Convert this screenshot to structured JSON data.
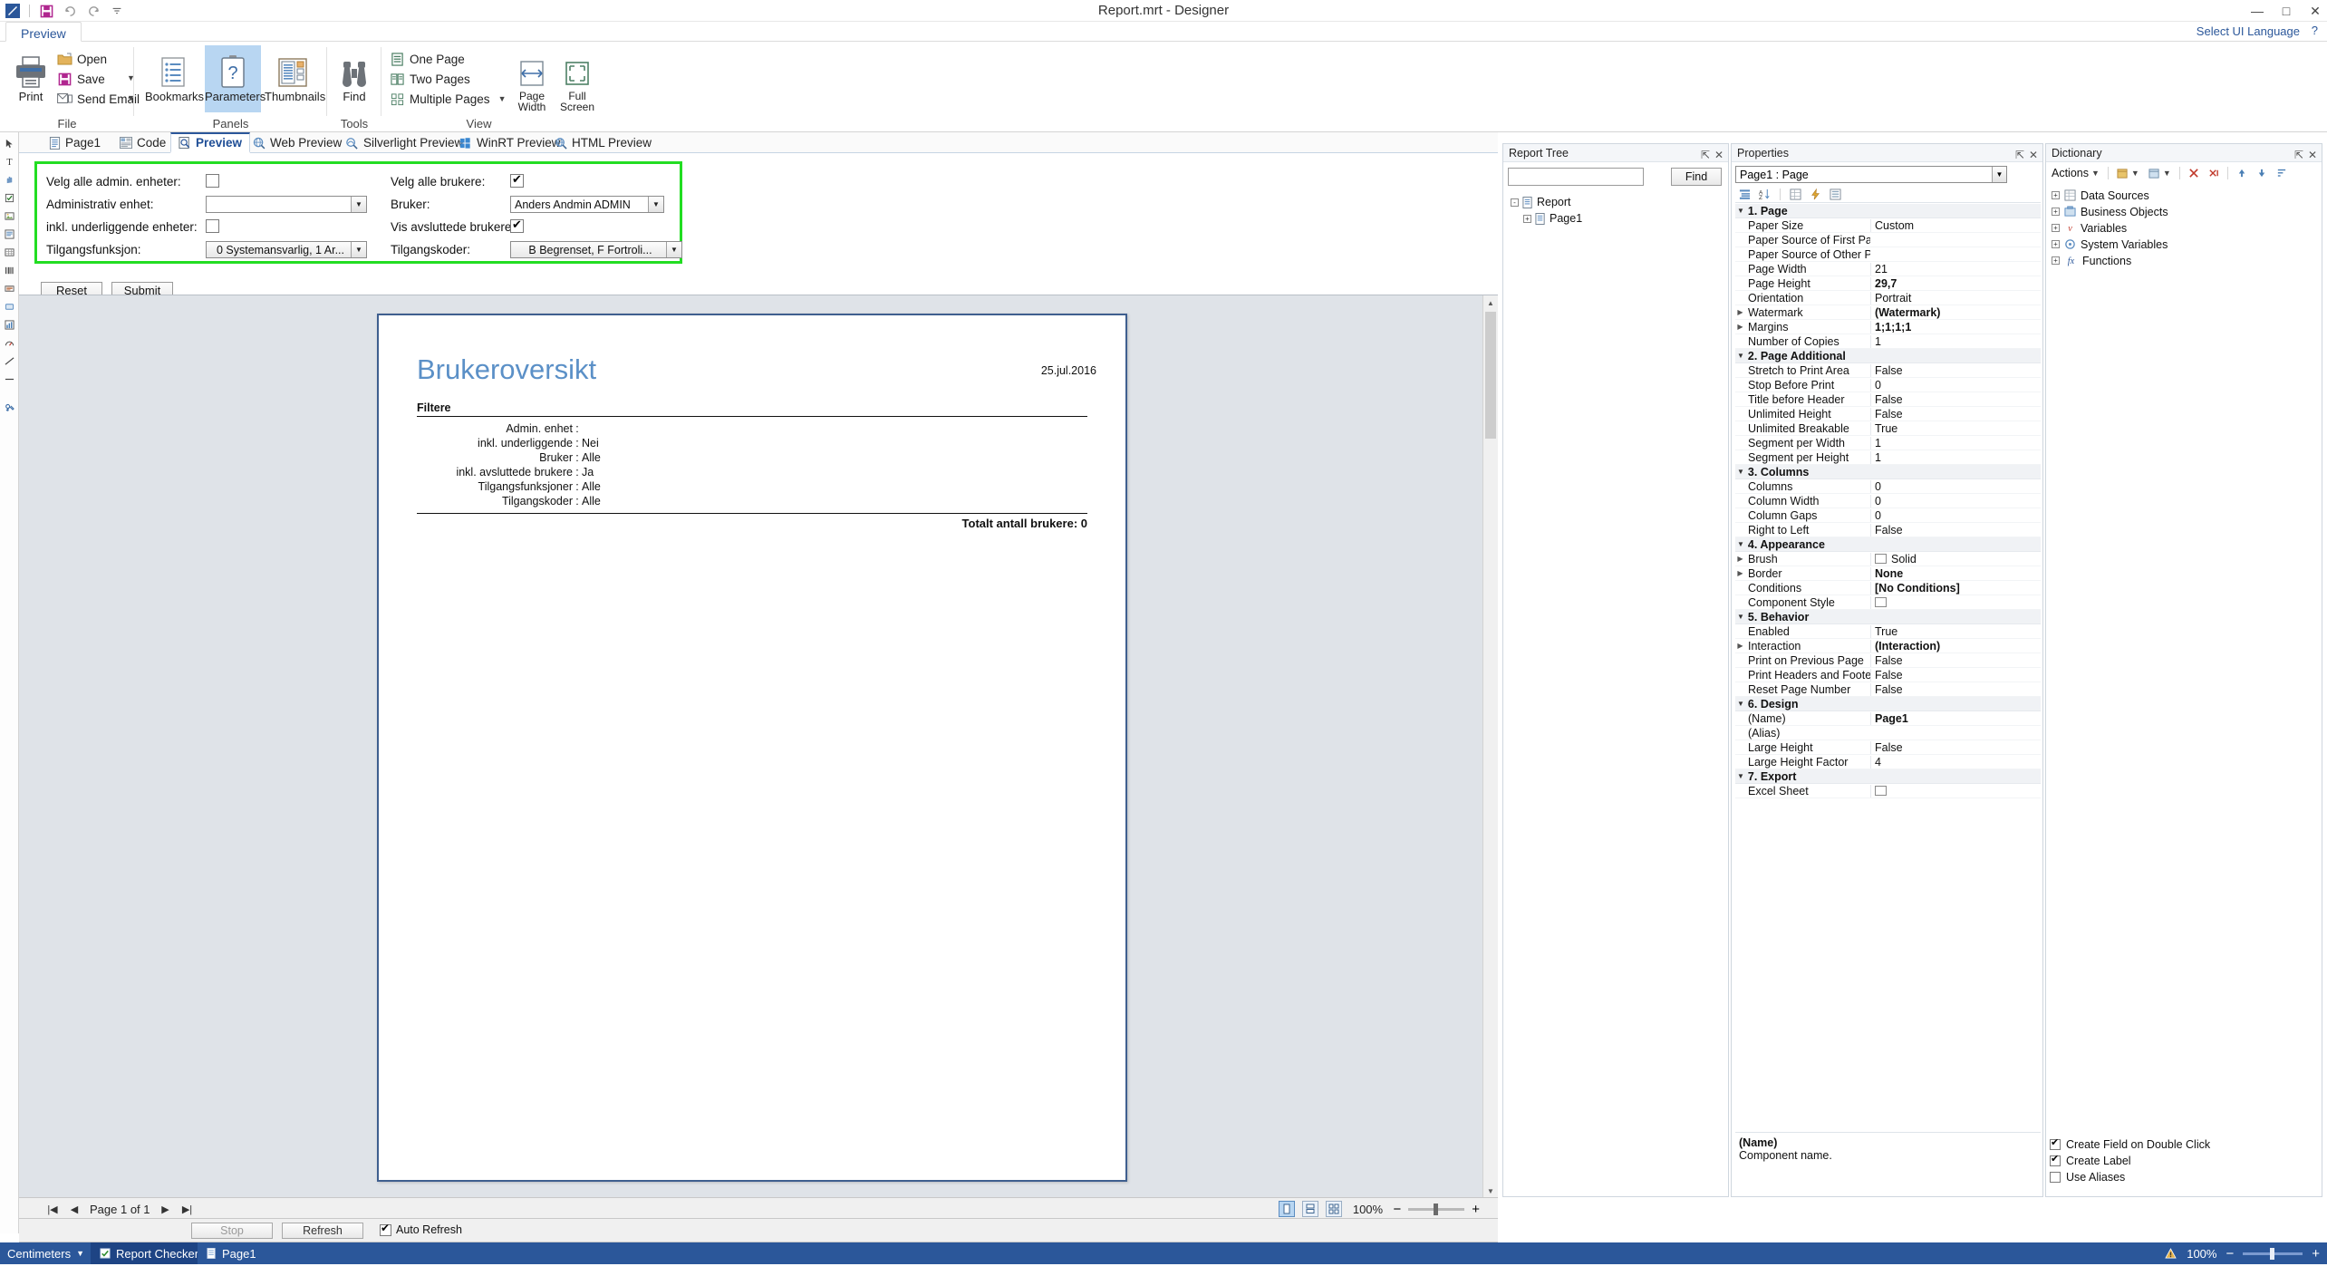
{
  "window": {
    "title": "Report.mrt - Designer",
    "quick_access": [
      "designer-logo-icon",
      "save-icon",
      "undo-icon",
      "redo-icon",
      "customize-qat-icon"
    ],
    "controls": {
      "minimize": "—",
      "maximize": "□",
      "close": "✕"
    }
  },
  "ribbon": {
    "tab": "Preview",
    "ui_language": "Select UI Language",
    "help": "?",
    "groups": [
      {
        "label": "File"
      },
      {
        "label": "Panels"
      },
      {
        "label": "Tools"
      },
      {
        "label": "View"
      }
    ],
    "buttons": {
      "print": "Print",
      "open": "Open",
      "save": "Save",
      "send_email": "Send Email",
      "bookmarks": "Bookmarks",
      "parameters": "Parameters",
      "thumbnails": "Thumbnails",
      "find": "Find",
      "one_page": "One Page",
      "two_pages": "Two Pages",
      "multiple_pages": "Multiple Pages",
      "page_width": "Page Width",
      "full_screen": "Full Screen"
    }
  },
  "doc_tabs": [
    {
      "label": "Page1",
      "icon": "page-icon",
      "active": false
    },
    {
      "label": "Code",
      "icon": "code-icon",
      "active": false
    },
    {
      "label": "Preview",
      "icon": "preview-icon",
      "active": true
    },
    {
      "label": "Web Preview",
      "icon": "web-preview-icon",
      "active": false
    },
    {
      "label": "Silverlight Preview",
      "icon": "silverlight-preview-icon",
      "active": false
    },
    {
      "label": "WinRT Preview",
      "icon": "winrt-preview-icon",
      "active": false
    },
    {
      "label": "HTML Preview",
      "icon": "html-preview-icon",
      "active": false
    }
  ],
  "parameters": {
    "left": [
      {
        "label": "Velg alle admin. enheter:",
        "type": "checkbox",
        "checked": false
      },
      {
        "label": "Administrativ enhet:",
        "type": "combo",
        "value": ""
      },
      {
        "label": "inkl. underliggende enheter:",
        "type": "checkbox",
        "checked": false
      },
      {
        "label": "Tilgangsfunksjon:",
        "type": "combo-button",
        "value": "0 Systemansvarlig, 1 Ar..."
      }
    ],
    "right": [
      {
        "label": "Velg alle brukere:",
        "type": "checkbox",
        "checked": true
      },
      {
        "label": "Bruker:",
        "type": "combo",
        "value": "Anders Andmin ADMIN"
      },
      {
        "label": "Vis avsluttede brukere:",
        "type": "checkbox",
        "checked": true
      },
      {
        "label": "Tilgangskoder:",
        "type": "combo-button",
        "value": "B Begrenset, F Fortroli..."
      }
    ],
    "reset_button": "Reset",
    "submit_button": "Submit"
  },
  "report": {
    "title": "Brukeroversikt",
    "date": "25.jul.2016",
    "filters_heading": "Filtere",
    "filters": [
      {
        "key": "Admin. enhet",
        "value": ""
      },
      {
        "key": "inkl. underliggende",
        "value": "Nei"
      },
      {
        "key": "Bruker",
        "value": "Alle"
      },
      {
        "key": "inkl. avsluttede brukere",
        "value": "Ja"
      },
      {
        "key": "Tilgangsfunksjoner",
        "value": "Alle"
      },
      {
        "key": "Tilgangskoder",
        "value": "Alle"
      }
    ],
    "total": "Totalt antall brukere: 0"
  },
  "preview_bar": {
    "page_indicator": "Page 1 of 1",
    "zoom": "100%",
    "nav": {
      "first": "|◀",
      "prev": "◀",
      "next": "▶",
      "last": "▶|"
    },
    "zoom_out": "−",
    "zoom_in": "+",
    "view_modes": [
      "single-page-view",
      "continuous-view",
      "multi-page-view"
    ]
  },
  "preview_controls": {
    "stop": "Stop",
    "refresh": "Refresh",
    "auto_refresh": "Auto Refresh",
    "auto_refresh_checked": true
  },
  "report_tree": {
    "title": "Report Tree",
    "find_placeholder": "",
    "find_value": "",
    "find_button": "Find",
    "nodes": [
      {
        "label": "Report",
        "icon": "report-icon",
        "depth": 0,
        "expander": "-"
      },
      {
        "label": "Page1",
        "icon": "page-icon",
        "depth": 1,
        "expander": "+"
      }
    ]
  },
  "properties": {
    "title": "Properties",
    "selector": "Page1 : Page",
    "toolbar_icons": [
      "categorized-icon",
      "alphabetical-icon",
      "properties-icon",
      "events-icon",
      "filter-icon"
    ],
    "categories": [
      {
        "name": "1. Page",
        "rows": [
          {
            "name": "Paper Size",
            "value": "Custom",
            "bold": false,
            "expander": ""
          },
          {
            "name": "Paper Source of First Pa",
            "value": "",
            "bold": false,
            "expander": ""
          },
          {
            "name": "Paper Source of Other P",
            "value": "",
            "bold": false,
            "expander": ""
          },
          {
            "name": "Page Width",
            "value": "21",
            "bold": false,
            "expander": ""
          },
          {
            "name": "Page Height",
            "value": "29,7",
            "bold": true,
            "expander": ""
          },
          {
            "name": "Orientation",
            "value": "Portrait",
            "bold": false,
            "expander": ""
          },
          {
            "name": "Watermark",
            "value": "(Watermark)",
            "bold": true,
            "expander": "▶"
          },
          {
            "name": "Margins",
            "value": "1;1;1;1",
            "bold": true,
            "expander": "▶"
          },
          {
            "name": "Number of Copies",
            "value": "1",
            "bold": false,
            "expander": ""
          }
        ]
      },
      {
        "name": "2. Page  Additional",
        "rows": [
          {
            "name": "Stretch to Print Area",
            "value": "False",
            "bold": false,
            "expander": ""
          },
          {
            "name": "Stop Before Print",
            "value": "0",
            "bold": false,
            "expander": ""
          },
          {
            "name": "Title before Header",
            "value": "False",
            "bold": false,
            "expander": ""
          },
          {
            "name": "Unlimited Height",
            "value": "False",
            "bold": false,
            "expander": ""
          },
          {
            "name": "Unlimited Breakable",
            "value": "True",
            "bold": false,
            "expander": ""
          },
          {
            "name": "Segment per Width",
            "value": "1",
            "bold": false,
            "expander": ""
          },
          {
            "name": "Segment per Height",
            "value": "1",
            "bold": false,
            "expander": ""
          }
        ]
      },
      {
        "name": "3. Columns",
        "rows": [
          {
            "name": "Columns",
            "value": "0",
            "bold": false,
            "expander": ""
          },
          {
            "name": "Column Width",
            "value": "0",
            "bold": false,
            "expander": ""
          },
          {
            "name": "Column Gaps",
            "value": "0",
            "bold": false,
            "expander": ""
          },
          {
            "name": "Right to Left",
            "value": "False",
            "bold": false,
            "expander": ""
          }
        ]
      },
      {
        "name": "4. Appearance",
        "rows": [
          {
            "name": "Brush",
            "value": "Solid",
            "bold": false,
            "expander": "▶",
            "swatch": "#ffffff"
          },
          {
            "name": "Border",
            "value": "None",
            "bold": true,
            "expander": "▶"
          },
          {
            "name": "Conditions",
            "value": "[No Conditions]",
            "bold": true,
            "expander": ""
          },
          {
            "name": "Component Style",
            "value": "",
            "bold": false,
            "expander": "",
            "swatch": "#ffffff"
          }
        ]
      },
      {
        "name": "5. Behavior",
        "rows": [
          {
            "name": "Enabled",
            "value": "True",
            "bold": false,
            "expander": ""
          },
          {
            "name": "Interaction",
            "value": "(Interaction)",
            "bold": true,
            "expander": "▶"
          },
          {
            "name": "Print on Previous Page",
            "value": "False",
            "bold": false,
            "expander": ""
          },
          {
            "name": "Print Headers and Foote",
            "value": "False",
            "bold": false,
            "expander": ""
          },
          {
            "name": "Reset Page Number",
            "value": "False",
            "bold": false,
            "expander": ""
          }
        ]
      },
      {
        "name": "6. Design",
        "rows": [
          {
            "name": "(Name)",
            "value": "Page1",
            "bold": true,
            "expander": ""
          },
          {
            "name": "(Alias)",
            "value": "",
            "bold": false,
            "expander": ""
          },
          {
            "name": "Large Height",
            "value": "False",
            "bold": false,
            "expander": ""
          },
          {
            "name": "Large Height Factor",
            "value": "4",
            "bold": false,
            "expander": ""
          }
        ]
      },
      {
        "name": "7. Export",
        "rows": [
          {
            "name": "Excel Sheet",
            "value": "",
            "bold": false,
            "expander": "",
            "swatch": "#ffffff"
          }
        ]
      }
    ],
    "footer_title": "(Name)",
    "footer_desc": "Component name."
  },
  "dictionary": {
    "title": "Dictionary",
    "actions_label": "Actions",
    "nodes": [
      {
        "label": "Data Sources",
        "icon": "data-sources-icon",
        "expander": "+"
      },
      {
        "label": "Business Objects",
        "icon": "business-objects-icon",
        "expander": "+"
      },
      {
        "label": "Variables",
        "icon": "variables-icon",
        "expander": "+"
      },
      {
        "label": "System Variables",
        "icon": "system-variables-icon",
        "expander": "+"
      },
      {
        "label": "Functions",
        "icon": "functions-icon",
        "expander": "+"
      }
    ],
    "options": [
      {
        "label": "Create Field on Double Click",
        "checked": true
      },
      {
        "label": "Create Label",
        "checked": true
      },
      {
        "label": "Use Aliases",
        "checked": false
      }
    ]
  },
  "statusbar": {
    "units": "Centimeters",
    "tabs": [
      {
        "label": "Report Checker",
        "icon": "checker-icon",
        "active": true
      },
      {
        "label": "Page1",
        "icon": "page-icon",
        "active": false
      }
    ],
    "zoom": "100%",
    "zoom_out": "−",
    "zoom_in": "+",
    "accent_color": "#2b579a"
  }
}
